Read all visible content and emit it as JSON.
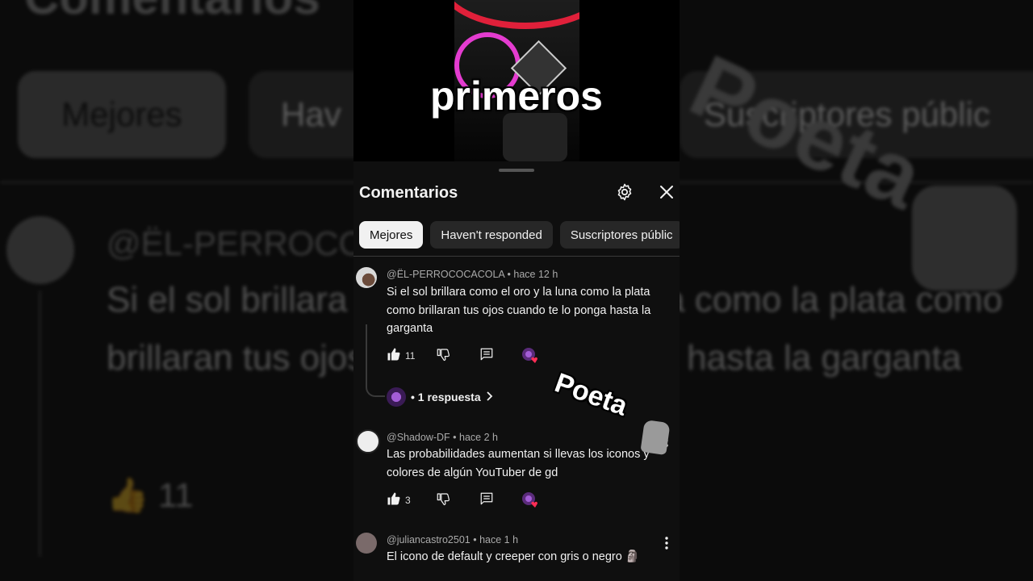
{
  "background": {
    "title": "Comentarios",
    "chips": [
      "Mejores",
      "Hav",
      "Suscriptores públic"
    ],
    "author": "@ËL-PERROCOC",
    "text": "Si el sol brillara como el oro y la luna como la plata como brillaran tus ojos cuando te lo ponga hasta la garganta",
    "likes": "11",
    "sticker": "Poeta"
  },
  "video": {
    "overlay_word": "primeros"
  },
  "panel": {
    "title": "Comentarios",
    "chips": [
      "Mejores",
      "Haven't responded",
      "Suscriptores públic"
    ],
    "sticker_text": "Poeta"
  },
  "comments": [
    {
      "author": "@ËL-PERROCOCACOLA",
      "time": "hace 12 h",
      "text": "Si el sol brillara como el oro y la luna como la plata como brillaran tus ojos cuando te lo ponga hasta la garganta",
      "likes": "11",
      "replies_label": "• 1 respuesta"
    },
    {
      "author": "@Shadow-DF",
      "time": "hace 2 h",
      "text": "Las probabilidades aumentan si llevas los iconos y colores de algún YouTuber de gd",
      "likes": "3"
    },
    {
      "author": "@juliancastro2501",
      "time": "hace 1 h",
      "text": "El icono de default y creeper con gris o negro 🗿",
      "likes": ""
    }
  ],
  "colors": {
    "panel_bg": "#0f0f0f",
    "chip_bg": "#272727",
    "active_chip": "#f1f1f1",
    "heart": "#ff2d55"
  }
}
